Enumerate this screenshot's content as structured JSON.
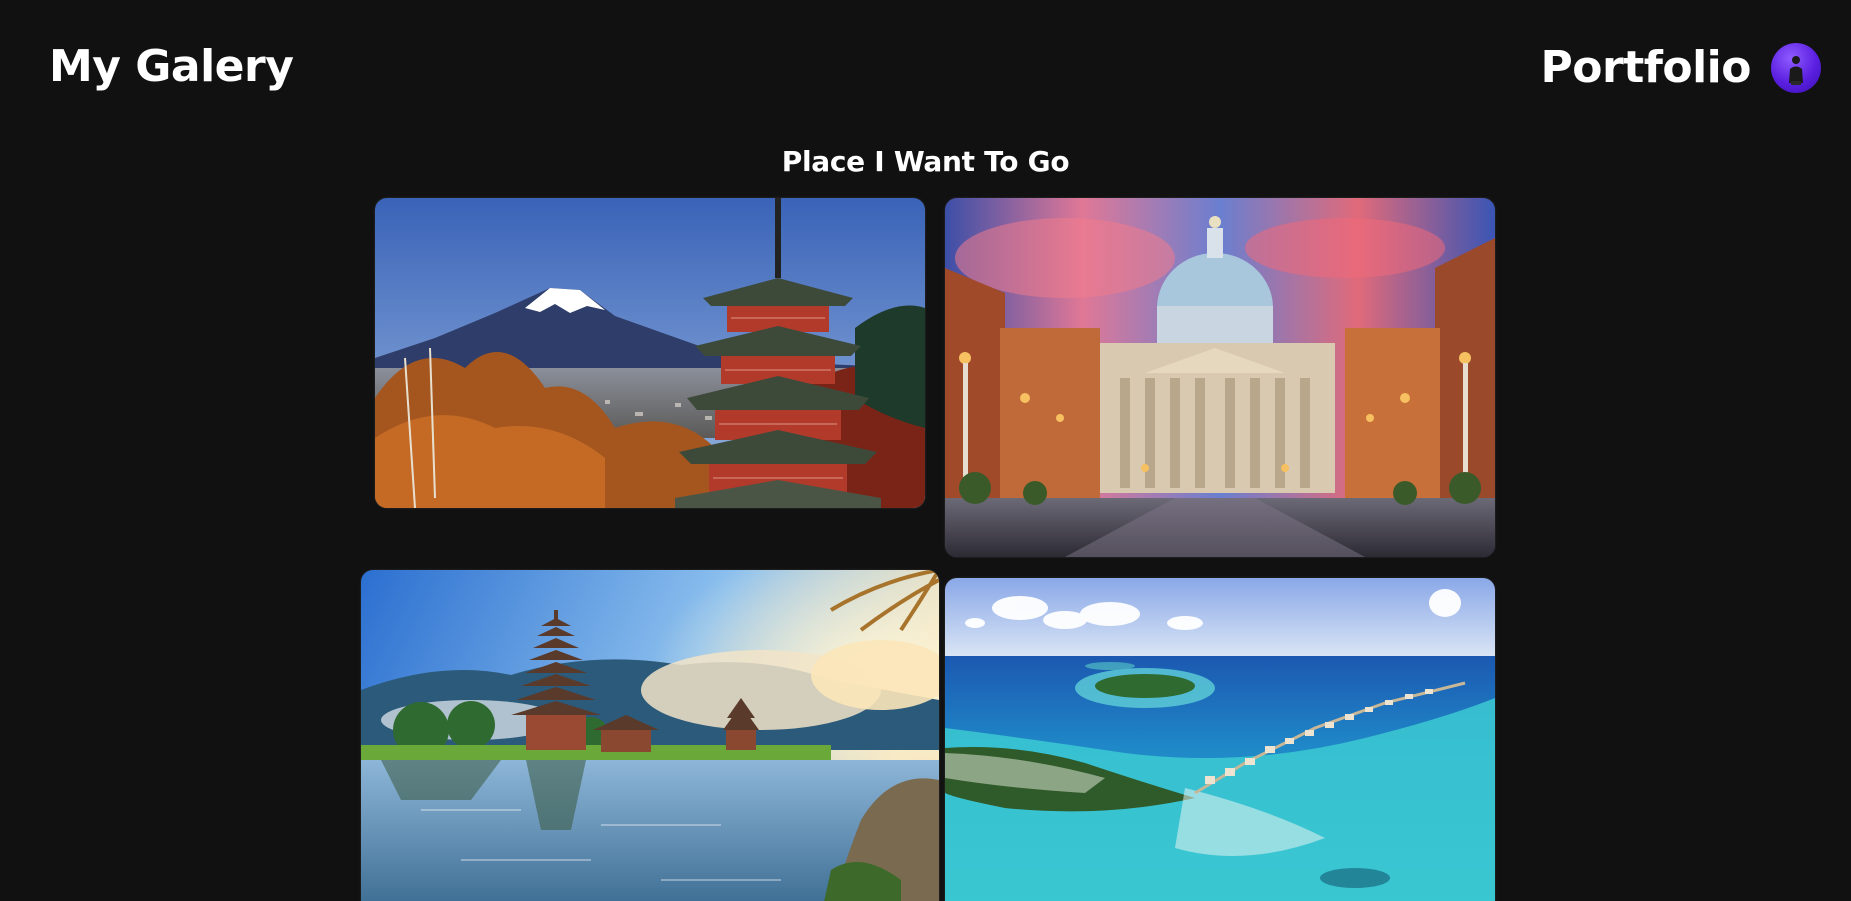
{
  "header": {
    "site_title": "My Galery",
    "nav_link": "Portfolio"
  },
  "gallery": {
    "heading": "Place I Want To Go",
    "photos": [
      {
        "name": "mount-fuji-pagoda-photo"
      },
      {
        "name": "st-peters-basilica-photo"
      },
      {
        "name": "bali-water-temple-photo"
      },
      {
        "name": "maldives-island-resort-photo"
      }
    ]
  },
  "colors": {
    "background": "#111111",
    "text": "#ffffff",
    "avatar_accent": "#5a1fe0"
  }
}
